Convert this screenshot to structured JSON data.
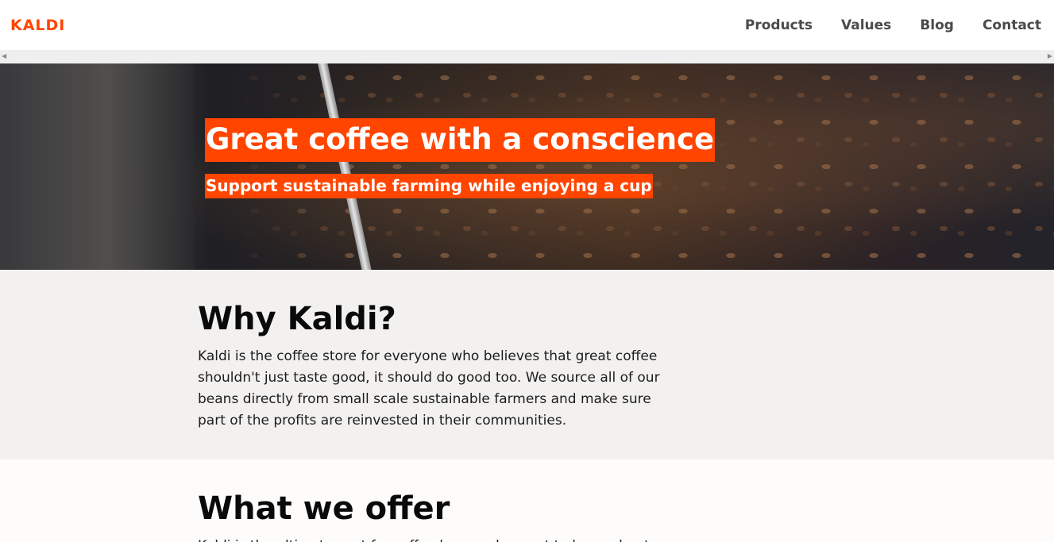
{
  "nav": {
    "logo": "KALDI",
    "links": [
      "Products",
      "Values",
      "Blog",
      "Contact"
    ]
  },
  "hero": {
    "title": "Great coffee with a conscience",
    "subtitle": "Support sustainable farming while enjoying a cup"
  },
  "why": {
    "heading": "Why Kaldi?",
    "body": "Kaldi is the coffee store for everyone who believes that great coffee shouldn't just taste good, it should do good too. We source all of our beans directly from small scale sustainable farmers and make sure part of the profits are reinvested in their communities."
  },
  "offer": {
    "heading": "What we offer",
    "body": "Kaldi is the ultimate spot for coffee lovers who want to learn about"
  },
  "colors": {
    "accent": "#ff4500",
    "nav_text": "#4a4a4a",
    "section_alt_bg": "#f2f1f0"
  }
}
